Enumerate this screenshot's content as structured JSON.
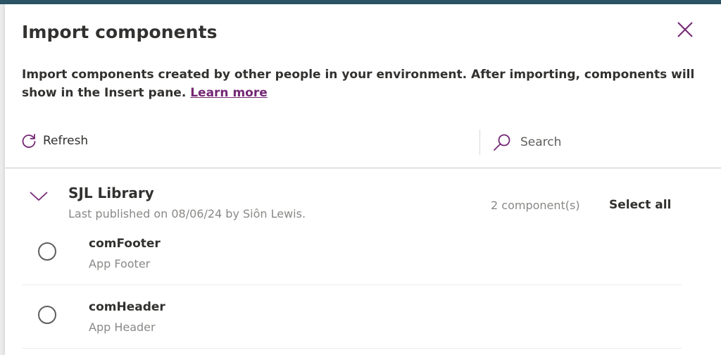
{
  "dialog": {
    "title": "Import components",
    "description": "Import components created by other people in your environment. After importing, components will show in the Insert pane.",
    "learn_more": "Learn more",
    "close_icon": "close-icon"
  },
  "toolbar": {
    "refresh_label": "Refresh",
    "refresh_icon": "refresh-icon",
    "search_placeholder": "Search",
    "search_icon": "search-icon"
  },
  "library": {
    "name": "SJL Library",
    "published": "Last published on 08/06/24 by Siôn Lewis.",
    "count": "2 component(s)",
    "select_all": "Select all",
    "expanded": true,
    "items": [
      {
        "name": "comFooter",
        "description": "App Footer",
        "selected": false
      },
      {
        "name": "comHeader",
        "description": "App Header",
        "selected": false
      }
    ]
  },
  "colors": {
    "accent": "#742774",
    "topbar": "#2b5566",
    "text": "#323130",
    "muted": "#8a8886"
  }
}
